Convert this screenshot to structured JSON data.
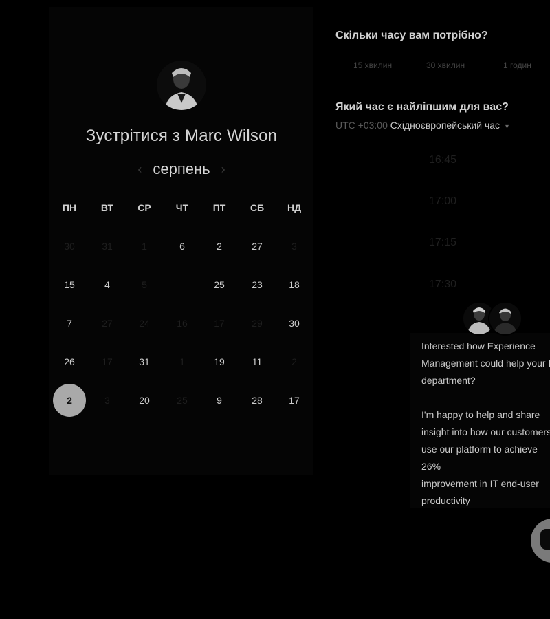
{
  "scheduler": {
    "title": "Зустрітися з Marc Wilson",
    "month": "серпень",
    "prev_icon": "chevron-left-icon",
    "next_icon": "chevron-right-icon",
    "weekdays": [
      "ПН",
      "ВТ",
      "СР",
      "ЧТ",
      "ПТ",
      "СБ",
      "НД"
    ],
    "weeks": [
      [
        {
          "t": "30",
          "dim": true
        },
        {
          "t": "31",
          "dim": true
        },
        {
          "t": "1",
          "dim": true
        },
        {
          "t": "6",
          "dim": false
        },
        {
          "t": "2",
          "dim": false
        },
        {
          "t": "27",
          "dim": false
        },
        {
          "t": "3",
          "dim": true
        }
      ],
      [
        {
          "t": "15",
          "dim": false
        },
        {
          "t": "4",
          "dim": false
        },
        {
          "t": "5",
          "dim": true
        },
        {
          "t": "",
          "dim": true
        },
        {
          "t": "25",
          "dim": false
        },
        {
          "t": "23",
          "dim": false
        },
        {
          "t": "18",
          "dim": false
        }
      ],
      [
        {
          "t": "7",
          "dim": false
        },
        {
          "t": "27",
          "dim": true
        },
        {
          "t": "24",
          "dim": true
        },
        {
          "t": "16",
          "dim": true
        },
        {
          "t": "17",
          "dim": true
        },
        {
          "t": "29",
          "dim": true
        },
        {
          "t": "30",
          "dim": false
        }
      ],
      [
        {
          "t": "26",
          "dim": false
        },
        {
          "t": "17",
          "dim": true
        },
        {
          "t": "31",
          "dim": false
        },
        {
          "t": "1",
          "dim": true
        },
        {
          "t": "19",
          "dim": false
        },
        {
          "t": "11",
          "dim": false
        },
        {
          "t": "2",
          "dim": true
        }
      ],
      [
        {
          "t": "2",
          "dim": false,
          "selected": true
        },
        {
          "t": "3",
          "dim": true
        },
        {
          "t": "20",
          "dim": false
        },
        {
          "t": "25",
          "dim": true
        },
        {
          "t": "9",
          "dim": false
        },
        {
          "t": "28",
          "dim": false
        },
        {
          "t": "17",
          "dim": false
        }
      ]
    ]
  },
  "booking": {
    "duration_question": "Скільки часу вам потрібно?",
    "durations": [
      "15 хвилин",
      "30 хвилин",
      "1 годин"
    ],
    "time_question": "Який час є найліпшим для вас?",
    "timezone_offset": "UTC +03:00",
    "timezone_name": "Східноєвропейський час",
    "timezone_caret": "▾",
    "time_slots": [
      "16:45",
      "17:00",
      "17:15",
      "17:30"
    ]
  },
  "chat": {
    "paragraph1": "Interested how Experience\nManagement could help your IT\ndepartment?",
    "paragraph2": "I'm happy to help and share\ninsight into how our customers\nuse our platform to achieve 26%\nimprovement in IT end-user\nproductivity",
    "launcher_icon": "chat-bubble-icon"
  },
  "colors": {
    "background": "#000000",
    "selected_day": "#a9a9a9",
    "text": "#cfcfcf"
  }
}
